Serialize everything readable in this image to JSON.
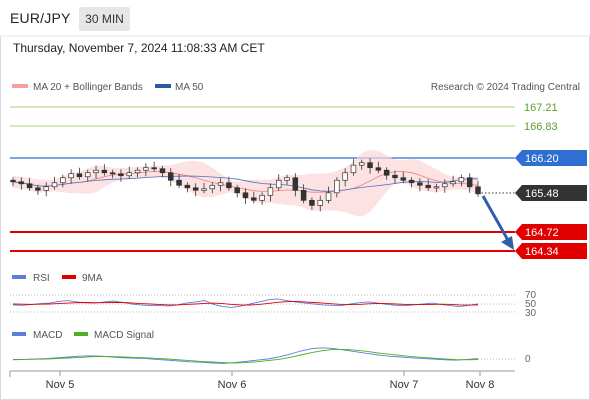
{
  "header": {
    "symbol": "EUR/JPY",
    "timeframe": "30 MIN",
    "datetime": "Thursday, November 7, 2024 11:08:33 AM CET"
  },
  "legend": {
    "ma20_label": "MA 20 + Bollinger Bands",
    "ma50_label": "MA 50",
    "credit": "Research © 2024 Trading Central",
    "colors": {
      "ma20": "#f08080",
      "ma50": "#2c5aa0"
    }
  },
  "levels": {
    "r2": {
      "label": "167.21",
      "color": "#8cc63f"
    },
    "r1": {
      "label": "166.83",
      "color": "#8cc63f"
    },
    "pivot": {
      "label": "166.20",
      "color": "#2f6fd1"
    },
    "last": {
      "label": "165.48",
      "color": "#333333"
    },
    "s1": {
      "label": "164.72",
      "color": "#e00000"
    },
    "s2": {
      "label": "164.34",
      "color": "#e00000"
    }
  },
  "rsi_panel": {
    "rsi_label": "RSI",
    "ma_label": "9MA",
    "ticks": [
      "70",
      "50",
      "30"
    ],
    "colors": {
      "rsi": "#5b7fd6",
      "ma": "#e00000"
    }
  },
  "macd_panel": {
    "macd_label": "MACD",
    "signal_label": "MACD Signal",
    "tick": "0",
    "colors": {
      "macd": "#5b7fd6",
      "signal": "#4caf1f"
    }
  },
  "x_axis": {
    "labels": [
      "Nov 5",
      "Nov 6",
      "Nov 7",
      "Nov 8"
    ]
  },
  "chart_data": {
    "type": "candlestick",
    "price_range": [
      164.2,
      167.4
    ],
    "closes": [
      165.72,
      165.68,
      165.6,
      165.55,
      165.62,
      165.7,
      165.8,
      165.88,
      165.82,
      165.9,
      165.95,
      165.9,
      165.88,
      165.84,
      165.9,
      165.95,
      166.0,
      165.98,
      165.9,
      165.75,
      165.65,
      165.6,
      165.55,
      165.58,
      165.65,
      165.7,
      165.6,
      165.5,
      165.4,
      165.35,
      165.45,
      165.6,
      165.75,
      165.8,
      165.55,
      165.35,
      165.25,
      165.35,
      165.5,
      165.75,
      165.9,
      166.05,
      166.1,
      166.0,
      165.95,
      165.85,
      165.8,
      165.75,
      165.7,
      165.65,
      165.6,
      165.62,
      165.68,
      165.72,
      165.8,
      165.62,
      165.48
    ],
    "rsi": [
      48,
      47,
      49,
      51,
      52,
      56,
      58,
      55,
      53,
      52,
      55,
      57,
      54,
      50,
      48,
      46,
      47,
      45,
      48,
      52,
      55,
      58,
      49,
      44,
      42,
      45,
      50,
      55,
      60,
      62,
      58,
      55,
      52,
      50,
      48,
      47,
      46,
      50,
      53,
      55,
      52,
      49,
      47,
      46,
      48,
      50,
      52,
      49,
      46,
      44,
      47,
      50
    ],
    "rsi_ma": [
      50,
      49.5,
      49,
      49.5,
      50,
      51,
      52,
      53,
      53.5,
      53,
      53,
      53.5,
      53.5,
      52.5,
      51,
      50,
      49,
      48,
      48,
      49,
      50,
      51.5,
      52,
      51,
      49,
      48,
      47.5,
      49,
      51.5,
      54,
      55.5,
      56,
      55,
      53.5,
      52,
      50.5,
      49,
      48.5,
      49,
      50.5,
      51.5,
      51,
      50,
      49,
      48.5,
      48.5,
      49,
      49.5,
      49,
      48,
      47.5,
      48
    ],
    "macd": [
      -0.02,
      -0.01,
      0.0,
      0.01,
      0.03,
      0.05,
      0.07,
      0.08,
      0.07,
      0.05,
      0.03,
      0.02,
      0.01,
      -0.01,
      -0.03,
      -0.05,
      -0.07,
      -0.08,
      -0.1,
      -0.11,
      -0.09,
      -0.06,
      -0.03,
      0.0,
      0.05,
      0.12,
      0.2,
      0.26,
      0.28,
      0.26,
      0.22,
      0.18,
      0.14,
      0.1,
      0.07,
      0.05,
      0.03,
      0.01,
      0.0,
      -0.02,
      -0.03,
      -0.01,
      0.01
    ],
    "macd_signal": [
      -0.01,
      -0.01,
      -0.005,
      0.0,
      0.01,
      0.025,
      0.04,
      0.055,
      0.065,
      0.06,
      0.05,
      0.04,
      0.03,
      0.015,
      0.0,
      -0.02,
      -0.04,
      -0.06,
      -0.075,
      -0.09,
      -0.1,
      -0.09,
      -0.07,
      -0.04,
      -0.01,
      0.04,
      0.1,
      0.16,
      0.21,
      0.24,
      0.24,
      0.22,
      0.19,
      0.15,
      0.12,
      0.09,
      0.06,
      0.04,
      0.02,
      0.0,
      -0.015,
      -0.02,
      -0.015
    ]
  }
}
